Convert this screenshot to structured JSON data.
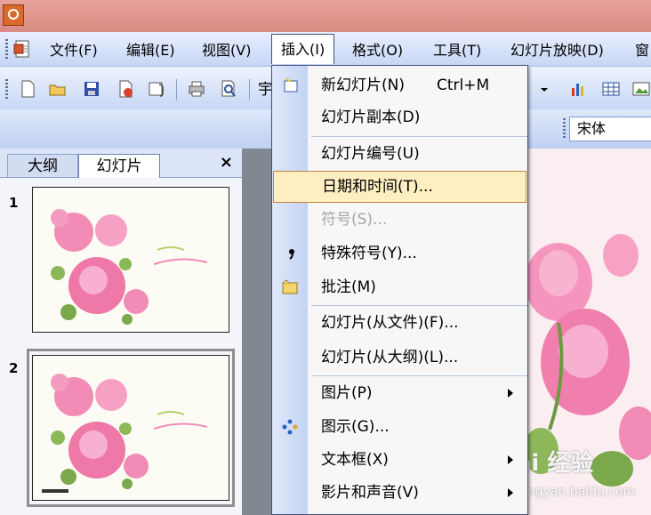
{
  "menubar": {
    "items": [
      {
        "label": "文件(F)"
      },
      {
        "label": "编辑(E)"
      },
      {
        "label": "视图(V)"
      },
      {
        "label": "插入(I)"
      },
      {
        "label": "格式(O)"
      },
      {
        "label": "工具(T)"
      },
      {
        "label": "幻灯片放映(D)"
      },
      {
        "label": "窗"
      }
    ]
  },
  "toolbar": {
    "font_name": "宋体",
    "partial_glyph": "宇"
  },
  "left_pane": {
    "tabs": [
      {
        "label": "大纲"
      },
      {
        "label": "幻灯片"
      }
    ],
    "close": "×",
    "slides": [
      {
        "number": "1"
      },
      {
        "number": "2"
      }
    ]
  },
  "insert_menu": {
    "items": [
      {
        "label": "新幻灯片(N)",
        "shortcut": "Ctrl+M",
        "icon": "new-slide-icon"
      },
      {
        "label": "幻灯片副本(D)"
      },
      {
        "label": "幻灯片编号(U)"
      },
      {
        "label": "日期和时间(T)...",
        "highlighted": true
      },
      {
        "label": "符号(S)...",
        "disabled": true
      },
      {
        "label": "特殊符号(Y)...",
        "icon": "special-symbol-icon"
      },
      {
        "label": "批注(M)",
        "icon": "comment-icon"
      },
      {
        "label": "幻灯片(从文件)(F)..."
      },
      {
        "label": "幻灯片(从大纲)(L)..."
      },
      {
        "label": "图片(P)",
        "submenu": true
      },
      {
        "label": "图示(G)...",
        "icon": "diagram-icon"
      },
      {
        "label": "文本框(X)",
        "submenu": true
      },
      {
        "label": "影片和声音(V)",
        "submenu": true
      }
    ]
  },
  "watermark": {
    "text": "Bai 经验",
    "sub": "jingyan.baidu.com"
  },
  "colors": {
    "title_bar": "#d98b84",
    "menu_highlight": "#ffeec2",
    "highlight_border": "#c08440",
    "disabled_text": "#a5a5a5"
  }
}
